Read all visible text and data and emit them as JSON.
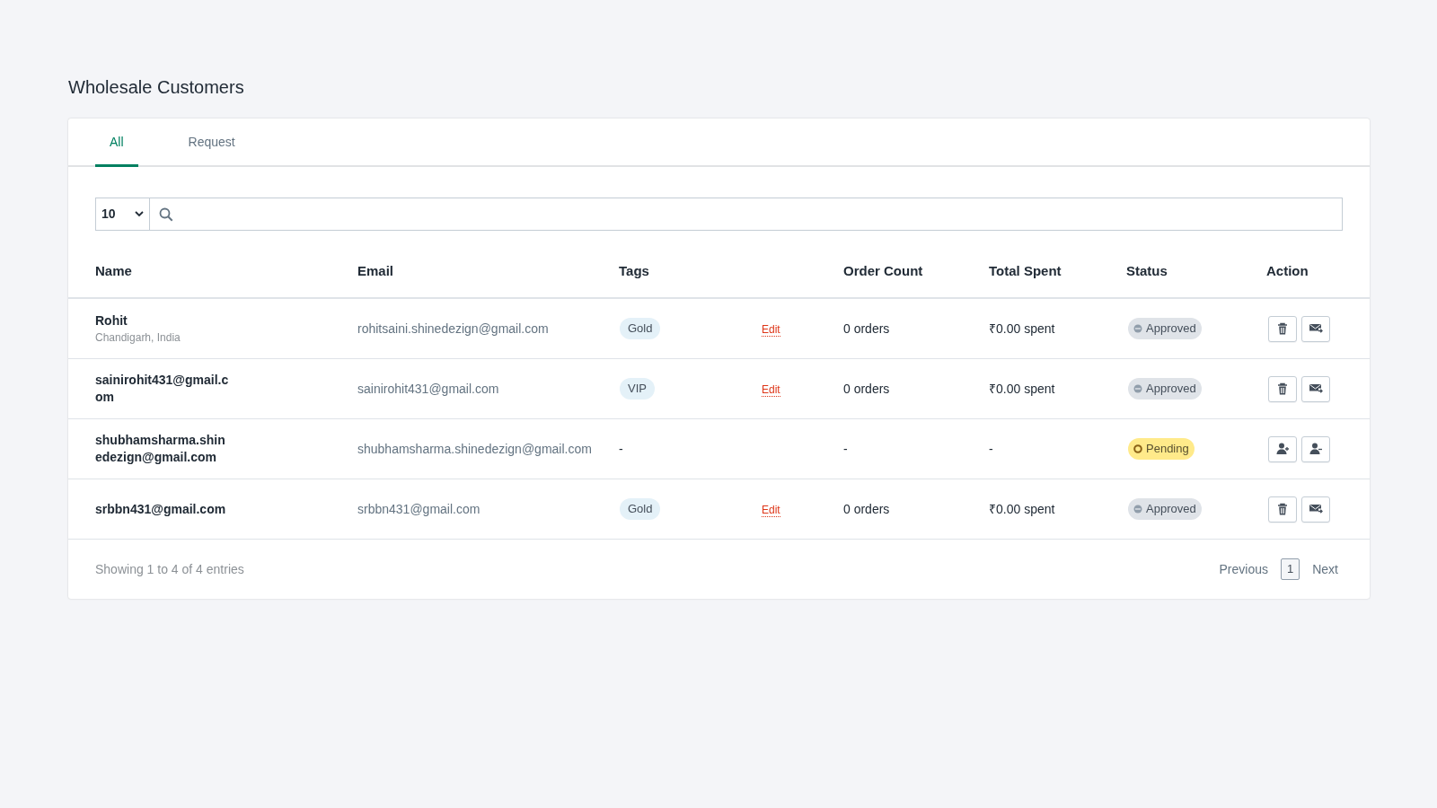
{
  "page": {
    "title": "Wholesale Customers"
  },
  "tabs": [
    {
      "label": "All",
      "selected": true
    },
    {
      "label": "Request",
      "selected": false
    }
  ],
  "page_length": {
    "value": "10"
  },
  "table": {
    "columns": [
      "Name",
      "Email",
      "Tags",
      "Order Count",
      "Total Spent",
      "Status",
      "Action"
    ],
    "rows": [
      {
        "name": "Rohit",
        "location": "Chandigarh, India",
        "email": "rohitsaini.shinedezign@gmail.com",
        "tag": {
          "kind": "badge",
          "text": "Gold"
        },
        "edit": "Edit",
        "order_count": "0 orders",
        "total_spent": "₹0.00 spent",
        "status": {
          "kind": "approved",
          "label": "Approved"
        },
        "actions": [
          {
            "kind": "delete"
          },
          {
            "kind": "email"
          }
        ]
      },
      {
        "name": "sainirohit431@gmail.com",
        "email": "sainirohit431@gmail.com",
        "tag": {
          "kind": "badge",
          "text": "VIP"
        },
        "edit": "Edit",
        "order_count": "0 orders",
        "total_spent": "₹0.00 spent",
        "status": {
          "kind": "approved",
          "label": "Approved"
        },
        "actions": [
          {
            "kind": "delete"
          },
          {
            "kind": "email"
          }
        ]
      },
      {
        "name": "shubhamsharma.shinedezign@gmail.com",
        "email": "shubhamsharma.shinedezign@gmail.com",
        "tag": {
          "kind": "plain",
          "text": "-"
        },
        "order_count": "-",
        "total_spent": "-",
        "status": {
          "kind": "pending",
          "label": "Pending"
        },
        "actions": [
          {
            "kind": "approve"
          },
          {
            "kind": "reject"
          }
        ]
      },
      {
        "name": "srbbn431@gmail.com",
        "email": "srbbn431@gmail.com",
        "tag": {
          "kind": "badge",
          "text": "Gold"
        },
        "edit": "Edit",
        "order_count": "0 orders",
        "total_spent": "₹0.00 spent",
        "status": {
          "kind": "approved",
          "label": "Approved"
        },
        "actions": [
          {
            "kind": "delete"
          },
          {
            "kind": "email"
          }
        ]
      }
    ]
  },
  "footer": {
    "info": "Showing 1 to 4 of 4 entries",
    "previous": "Previous",
    "pages": [
      {
        "label": "1",
        "selected": true
      }
    ],
    "next": "Next"
  }
}
